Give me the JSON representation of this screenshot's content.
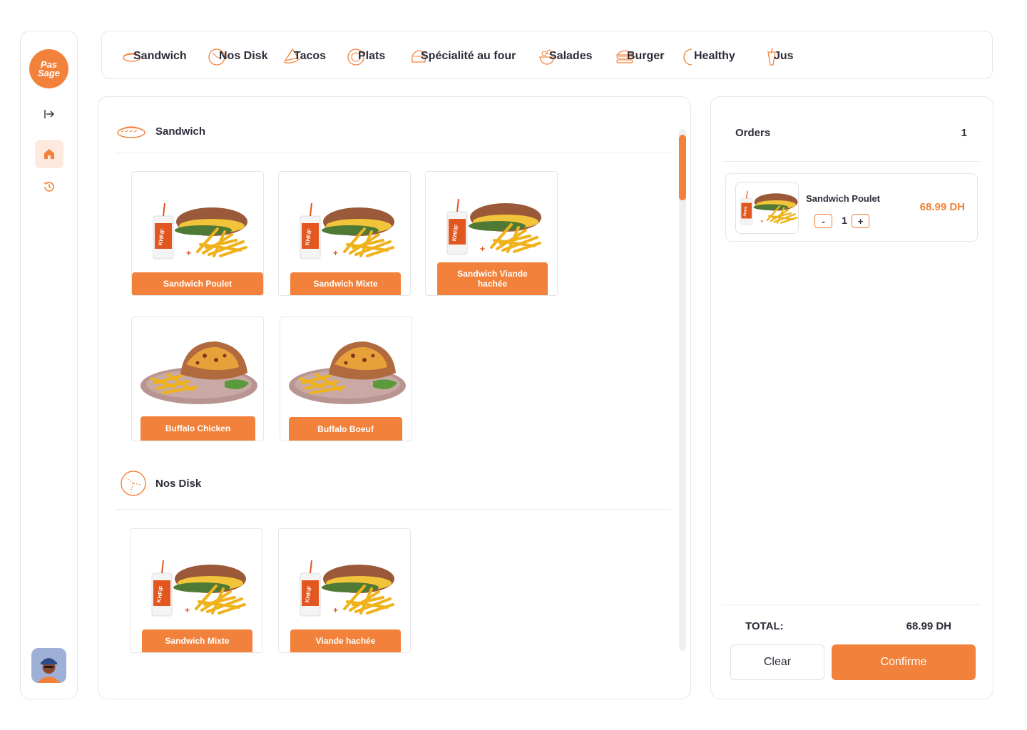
{
  "brand": {
    "logo_top": "Pas",
    "logo_bottom": "Sage",
    "accent": "#f2823b"
  },
  "sidebar": {
    "items": [
      {
        "icon": "collapse-arrow-icon"
      },
      {
        "icon": "home-icon",
        "active": true
      },
      {
        "icon": "history-icon"
      }
    ],
    "avatar_icon": "user-avatar"
  },
  "categories": [
    {
      "label": "Sandwich",
      "icon": "sandwich-icon"
    },
    {
      "label": "Nos Disk",
      "icon": "disk-icon"
    },
    {
      "label": "Tacos",
      "icon": "tacos-icon"
    },
    {
      "label": "Plats",
      "icon": "plate-icon"
    },
    {
      "label": "Spécialité au four",
      "icon": "oven-icon"
    },
    {
      "label": "Salades",
      "icon": "salad-icon"
    },
    {
      "label": "Burger",
      "icon": "burger-icon"
    },
    {
      "label": "Healthy",
      "icon": "healthy-icon"
    },
    {
      "label": "Jus",
      "icon": "juice-icon"
    }
  ],
  "sections": [
    {
      "title": "Sandwich",
      "products": [
        "Sandwich Poulet",
        "Sandwich Mixte",
        "Sandwich Viande hachée",
        "Buffalo Chicken",
        "Buffalo Boeuf"
      ]
    },
    {
      "title": "Nos Disk",
      "products": [
        "Sandwich Mixte",
        "Viande hachée"
      ]
    }
  ],
  "orders": {
    "title": "Orders",
    "count": "1",
    "items": [
      {
        "name": "Sandwich Poulet",
        "quantity": "1",
        "price": "68.99 DH",
        "minus": "-",
        "plus": "+"
      }
    ],
    "total_label": "TOTAL:",
    "total_value": "68.99 DH",
    "clear_label": "Clear",
    "confirm_label": "Confirme"
  }
}
